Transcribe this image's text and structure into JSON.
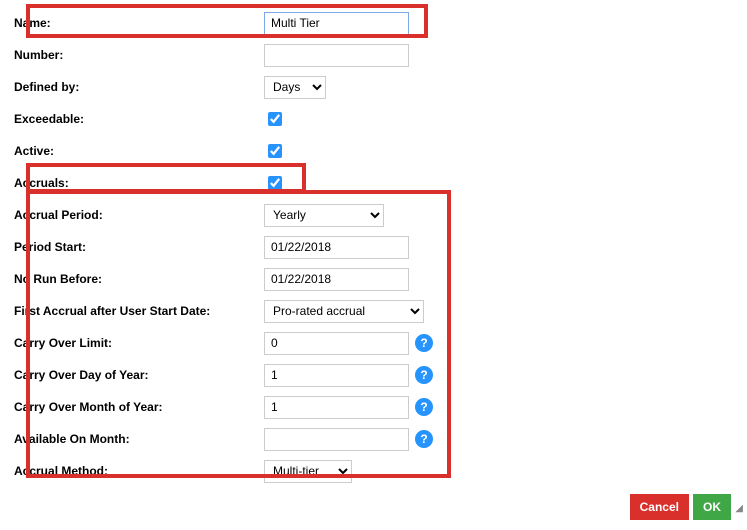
{
  "fields": {
    "name": {
      "label": "Name:",
      "value": "Multi Tier"
    },
    "number": {
      "label": "Number:",
      "value": ""
    },
    "defined_by": {
      "label": "Defined by:",
      "value": "Days"
    },
    "exceedable": {
      "label": "Exceedable:",
      "checked": true
    },
    "active": {
      "label": "Active:",
      "checked": true
    },
    "accruals": {
      "label": "Accruals:",
      "checked": true
    },
    "accrual_period": {
      "label": "Accrual Period:",
      "value": "Yearly"
    },
    "period_start": {
      "label": "Period Start:",
      "value": "01/22/2018"
    },
    "no_run_before": {
      "label": "No Run Before:",
      "value": "01/22/2018"
    },
    "first_accrual": {
      "label": "First Accrual after User Start Date:",
      "value": "Pro-rated accrual"
    },
    "carry_over_limit": {
      "label": "Carry Over Limit:",
      "value": "0"
    },
    "carry_over_day": {
      "label": "Carry Over Day of Year:",
      "value": "1"
    },
    "carry_over_month": {
      "label": "Carry Over Month of Year:",
      "value": "1"
    },
    "available_month": {
      "label": "Available On Month:",
      "value": ""
    },
    "accrual_method": {
      "label": "Accrual Method:",
      "value": "Multi-tier"
    }
  },
  "help_glyph": "?",
  "buttons": {
    "cancel": "Cancel",
    "ok": "OK"
  }
}
